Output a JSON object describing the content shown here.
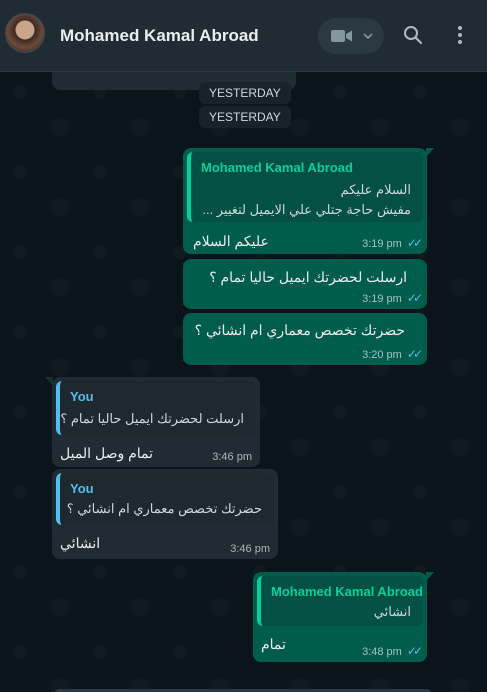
{
  "header": {
    "contact_name": "Mohamed Kamal Abroad",
    "icons": [
      "avatar",
      "video-call-icon",
      "chevron-down-icon",
      "search-icon",
      "menu-icon"
    ]
  },
  "date_chips": [
    "YESTERDAY",
    "YESTERDAY"
  ],
  "messages": [
    {
      "direction": "outgoing",
      "quote": {
        "author": "Mohamed Kamal Abroad",
        "lines": [
          "السلام عليكم",
          "مفيش حاجة جتلي علي الايميل لتغيير ..."
        ]
      },
      "text": "عليكم السلام",
      "time": "3:19 pm",
      "status": "read"
    },
    {
      "direction": "outgoing",
      "text": "ارسلت لحضرتك ايميل حاليا تمام ؟",
      "time": "3:19 pm",
      "status": "read"
    },
    {
      "direction": "outgoing",
      "text": "حضرتك تخصص معماري ام انشائي ؟",
      "time": "3:20 pm",
      "status": "read"
    },
    {
      "direction": "incoming",
      "quote": {
        "author": "You",
        "lines": [
          "ارسلت لحضرتك ايميل حاليا تمام ؟"
        ]
      },
      "text": "تمام وصل الميل",
      "time": "3:46 pm"
    },
    {
      "direction": "incoming",
      "quote": {
        "author": "You",
        "lines": [
          "حضرتك تخصص معماري ام انشائي ؟"
        ]
      },
      "text": "انشائي",
      "time": "3:46 pm"
    },
    {
      "direction": "outgoing",
      "quote": {
        "author": "Mohamed Kamal Abroad",
        "lines": [
          "انشائي"
        ]
      },
      "text": "تمام",
      "time": "3:48 pm",
      "status": "read"
    }
  ],
  "colors": {
    "header_bg": "#202c33",
    "chat_bg": "#0b141a",
    "outgoing_bubble": "#005c4b",
    "incoming_bubble": "#202c33",
    "accent_green": "#06cf9c",
    "accent_blue": "#53bdeb"
  }
}
